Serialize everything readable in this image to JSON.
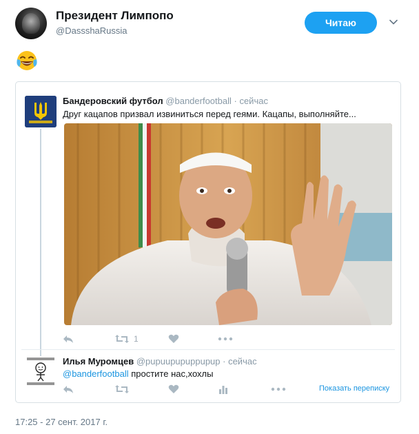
{
  "author": {
    "display_name": "Президент Лимпопо",
    "handle": "@DassshaRussia",
    "follow_label": "Читаю",
    "menu_icon": "chevron-down-icon"
  },
  "tweet": {
    "emoji_icon": "face-with-tears-of-joy-icon",
    "timestamp": "17:25 - 27 сент. 2017 г."
  },
  "quoted": {
    "first": {
      "name": "Бандеровский футбол",
      "handle": "@banderfootball",
      "time": "· сейчас",
      "text": "Друг кацапов призвал извиниться перед геями. Кацапы, выполняйте...",
      "retweet_count": "1",
      "avatar_icon": "ukraine-trident-logo-icon"
    },
    "reply": {
      "name": "Илья Муромцев",
      "handle": "@pupuupupuppupup",
      "time": "· сейчас",
      "mention": "@banderfootball",
      "text": " простите нас,хохлы",
      "show_thread": "Показать переписку"
    }
  },
  "colors": {
    "accent": "#1da1f2",
    "link": "#1b95e0",
    "muted": "#657786",
    "border": "#d7dfe4"
  }
}
